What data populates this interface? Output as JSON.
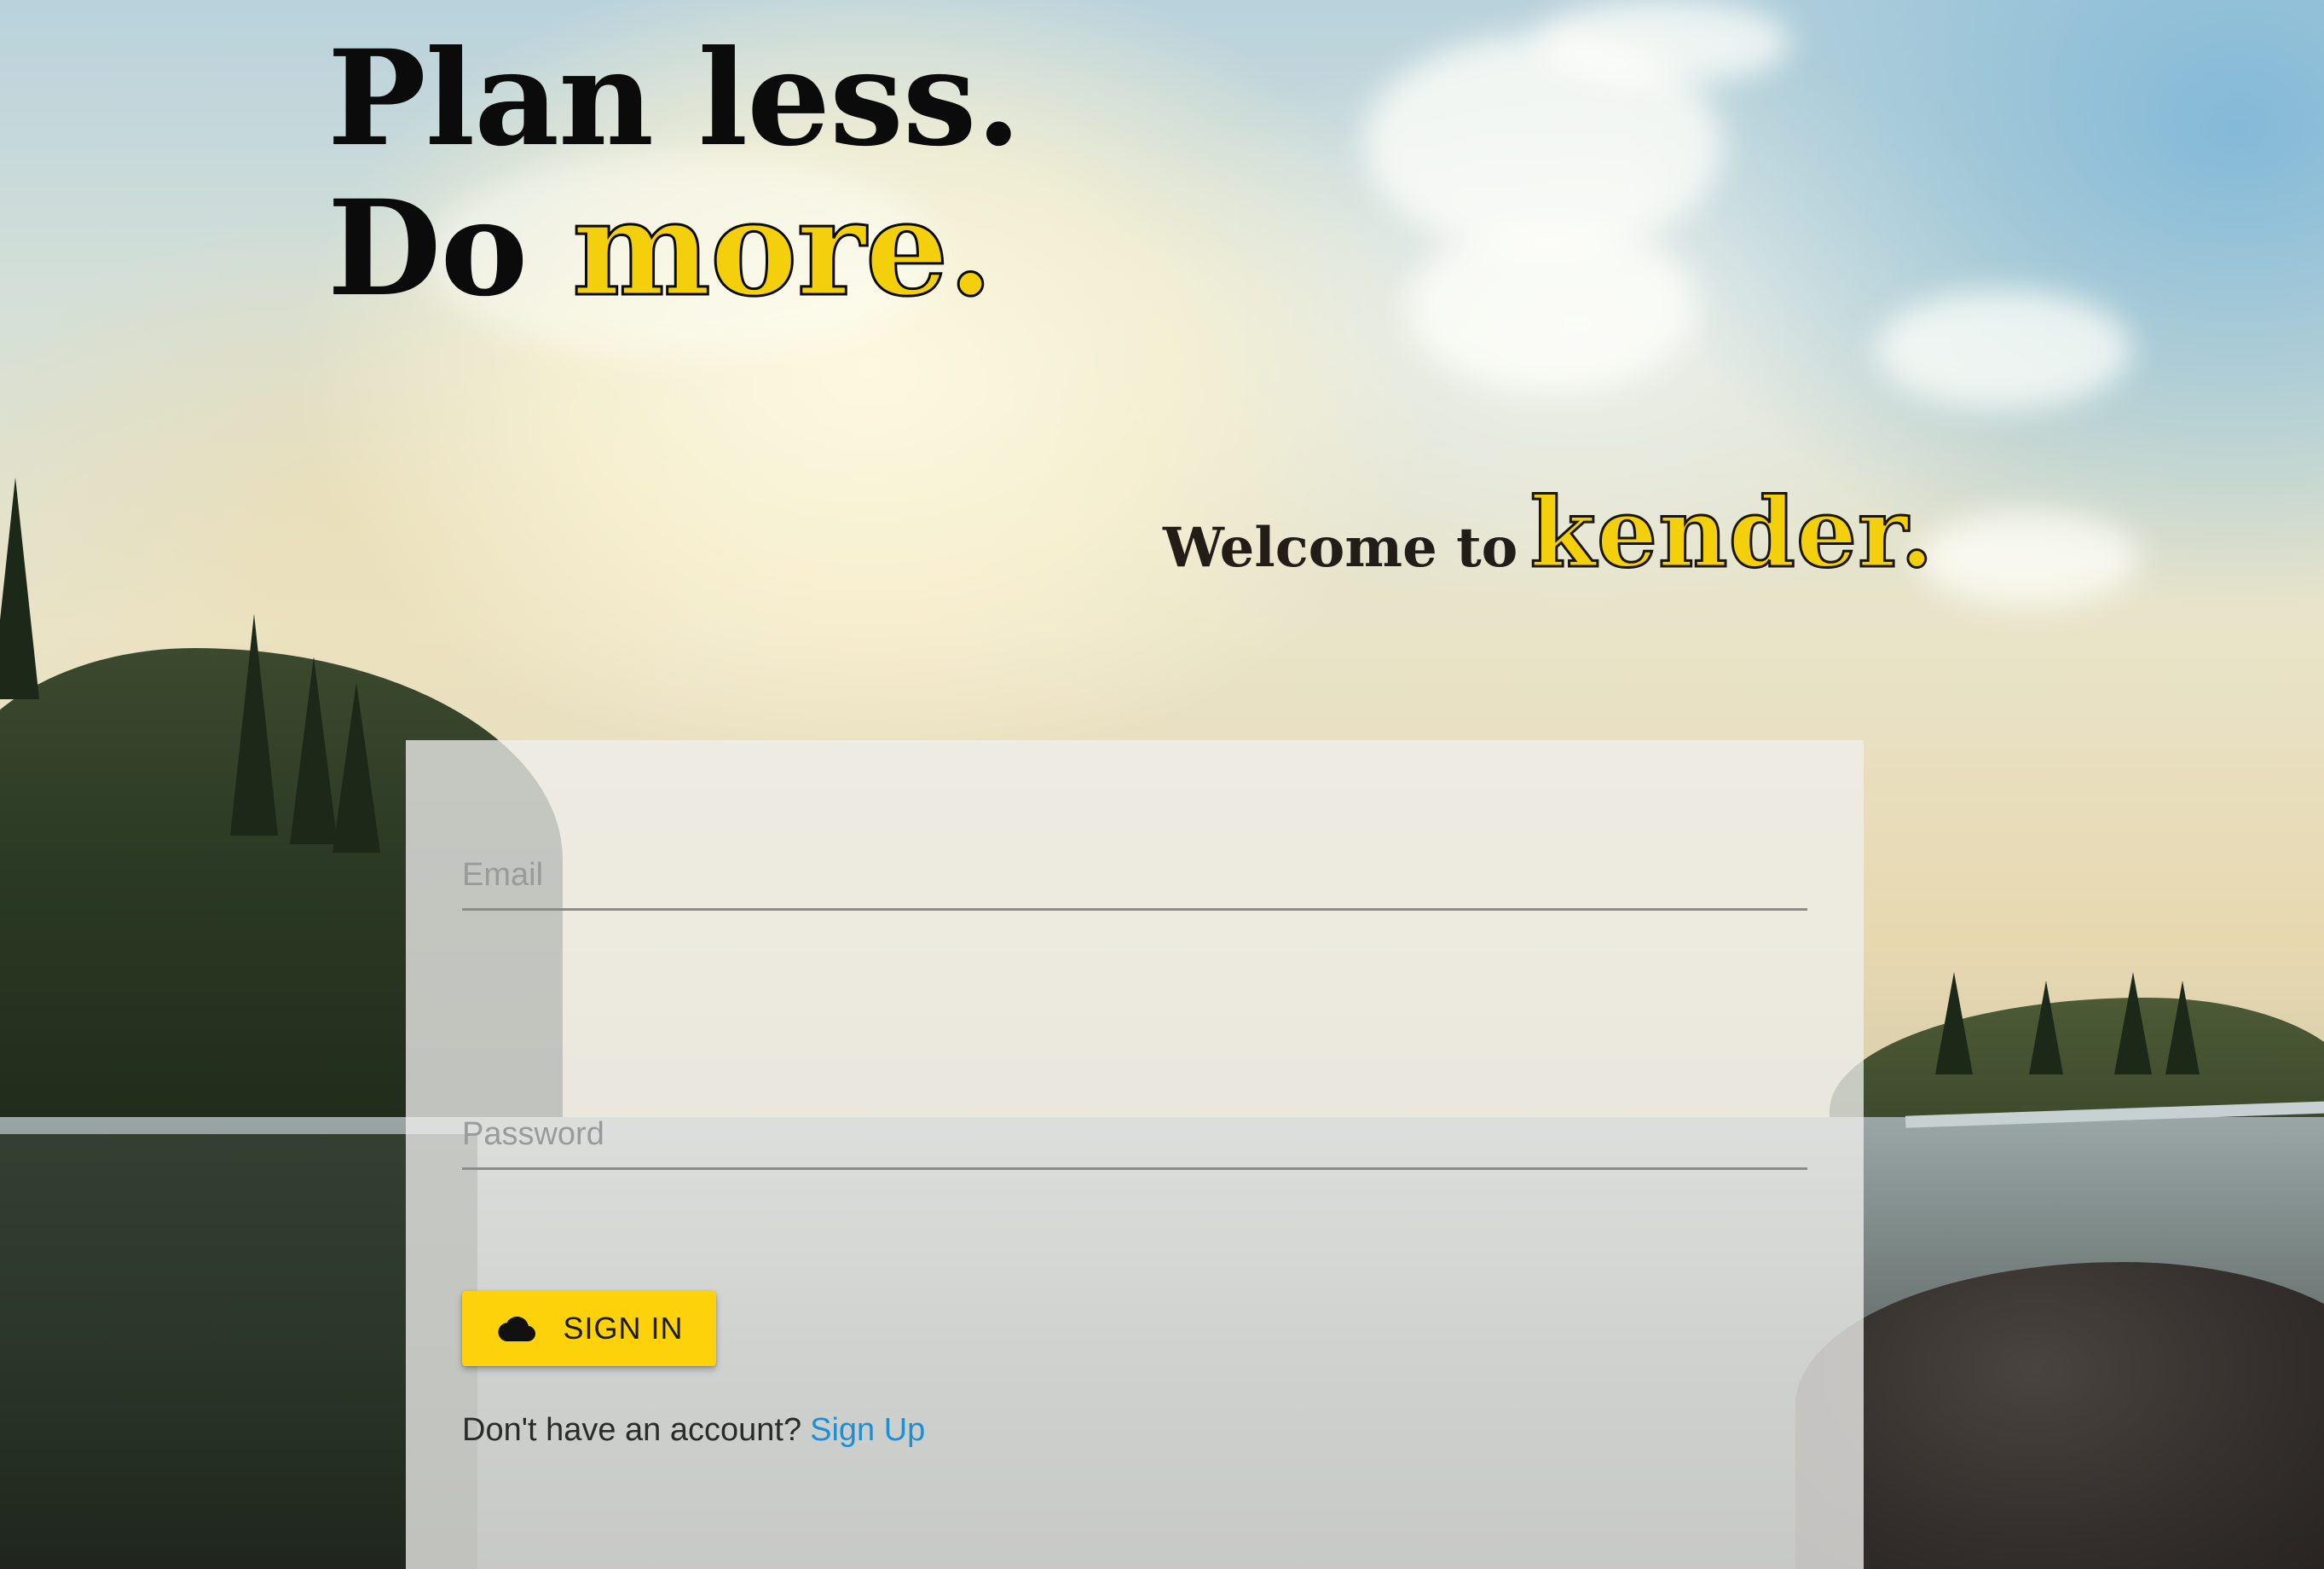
{
  "hero": {
    "line1": "Plan less.",
    "line2_prefix": "Do",
    "line2_accent": "more."
  },
  "welcome": {
    "prefix": "Welcome to",
    "brand": "kender."
  },
  "login": {
    "email_placeholder": "Email",
    "password_placeholder": "Password",
    "signin_label": "SIGN IN",
    "signin_icon": "cloud-icon",
    "no_account_text": "Don't have an account?",
    "signup_link": "Sign Up"
  },
  "colors": {
    "accent_yellow": "#f3cf0c",
    "button_yellow": "#fdd20a",
    "link_blue": "#1e8fd6"
  }
}
